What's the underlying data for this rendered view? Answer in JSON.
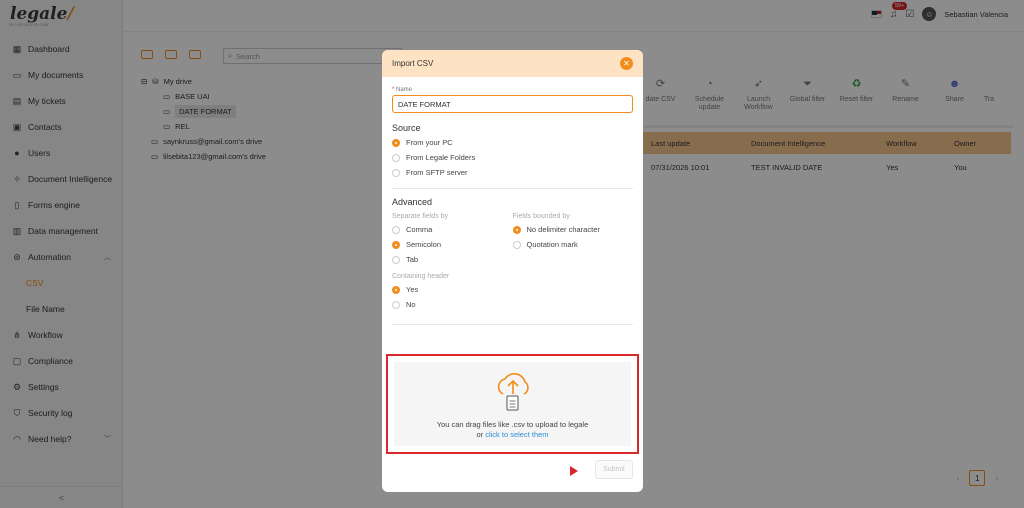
{
  "app": {
    "logo": "legale",
    "logo_sub": "BY ARGENTA ONE"
  },
  "sidebar": {
    "items": [
      {
        "label": "Dashboard",
        "icon": "dashboard-icon"
      },
      {
        "label": "My documents",
        "icon": "folder-icon"
      },
      {
        "label": "My tickets",
        "icon": "ticket-icon"
      },
      {
        "label": "Contacts",
        "icon": "contacts-icon"
      },
      {
        "label": "Users",
        "icon": "user-icon"
      },
      {
        "label": "Document Intelligence",
        "icon": "sparkle-icon"
      },
      {
        "label": "Forms engine",
        "icon": "form-icon"
      },
      {
        "label": "Data management",
        "icon": "data-icon"
      },
      {
        "label": "Automation",
        "icon": "automation-icon"
      },
      {
        "label": "CSV",
        "icon": ""
      },
      {
        "label": "File Name",
        "icon": ""
      },
      {
        "label": "Workflow",
        "icon": "workflow-icon"
      },
      {
        "label": "Compliance",
        "icon": "compliance-icon"
      },
      {
        "label": "Settings",
        "icon": "gear-icon"
      },
      {
        "label": "Security log",
        "icon": "shield-icon"
      },
      {
        "label": "Need help?",
        "icon": "headset-icon"
      }
    ],
    "collapse": "<"
  },
  "topbar": {
    "notification_count": "99+",
    "user_name": "Sebastian Valencia"
  },
  "main": {
    "search_placeholder": "Search",
    "tree": [
      {
        "label": "My drive"
      },
      {
        "label": "BASE UAI"
      },
      {
        "label": "DATE FORMAT"
      },
      {
        "label": "REL"
      },
      {
        "label": "saynkruss@gmail.com's drive"
      },
      {
        "label": "lilsebita123@gmail.com's drive"
      }
    ],
    "actions": [
      {
        "label": "date\nCSV",
        "icon": "update-icon"
      },
      {
        "label": "Schedule update",
        "icon": "schedule-icon"
      },
      {
        "label": "Launch Workflow",
        "icon": "rocket-icon"
      },
      {
        "label": "Global filter",
        "icon": "filter-icon"
      },
      {
        "label": "Reset filter",
        "icon": "recycle-icon"
      },
      {
        "label": "Rename",
        "icon": "edit-icon"
      },
      {
        "label": "Share",
        "icon": "share-icon"
      },
      {
        "label": "Tra",
        "icon": "trash-icon"
      }
    ],
    "table": {
      "headers": [
        "Last update",
        "Document Intelligence",
        "Workflow",
        "Owner"
      ],
      "rows": [
        [
          "07/31/2026 10:01",
          "TEST INVALID DATE",
          "Yes",
          "You"
        ]
      ]
    },
    "page": "1"
  },
  "modal": {
    "title": "Import CSV",
    "name_label": "Name",
    "name_value": "DATE FORMAT",
    "source_title": "Source",
    "source_options": [
      "From your PC",
      "From Legale Folders",
      "From SFTP server"
    ],
    "source_selected": 0,
    "advanced_title": "Advanced",
    "sep_label": "Separate fields by",
    "sep_options": [
      "Comma",
      "Semicolon",
      "Tab"
    ],
    "bound_label": "Fields bounded by",
    "bound_options": [
      "No delimiter character",
      "Quotation mark"
    ],
    "header_label": "Containing header",
    "header_options": [
      "Yes",
      "No"
    ],
    "upload_text": "You can drag files like .csv to upload to legale",
    "upload_or": "or",
    "upload_link": "click to select them",
    "submit": "Submit"
  },
  "colors": {
    "accent": "#f28c1b",
    "highlight": "#d9262b",
    "link": "#2a8fd6",
    "header_bg": "#f7c58f"
  }
}
